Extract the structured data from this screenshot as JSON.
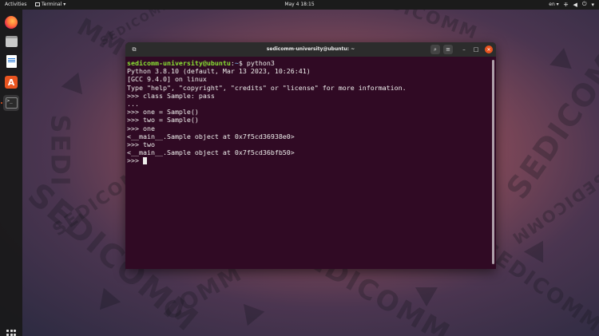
{
  "topbar": {
    "activities": "Activities",
    "app_menu": "Terminal",
    "clock": "May 4  18:15",
    "language": "en"
  },
  "dock": {
    "items": [
      "firefox-icon",
      "files-icon",
      "libreoffice-writer-icon",
      "ubuntu-software-icon",
      "terminal-icon"
    ],
    "show_apps": "show-applications-icon"
  },
  "window": {
    "title": "sedicomm-university@ubuntu: ~",
    "accent": "#e95420",
    "background": "#300a24"
  },
  "terminal": {
    "prompt_user": "sedicomm-university@ubuntu",
    "prompt_sep": ":",
    "prompt_path": "~",
    "prompt_dollar": "$ ",
    "command": "python3",
    "lines": [
      "Python 3.8.10 (default, Mar 13 2023, 10:26:41)",
      "[GCC 9.4.0] on linux",
      "Type \"help\", \"copyright\", \"credits\" or \"license\" for more information.",
      ">>> class Sample: pass",
      "...",
      ">>> one = Sample()",
      ">>> two = Sample()",
      ">>> one",
      "<__main__.Sample object at 0x7f5cd36938e0>",
      ">>> two",
      "<__main__.Sample object at 0x7f5cd36bfb50>"
    ],
    "final_prompt": ">>> "
  }
}
